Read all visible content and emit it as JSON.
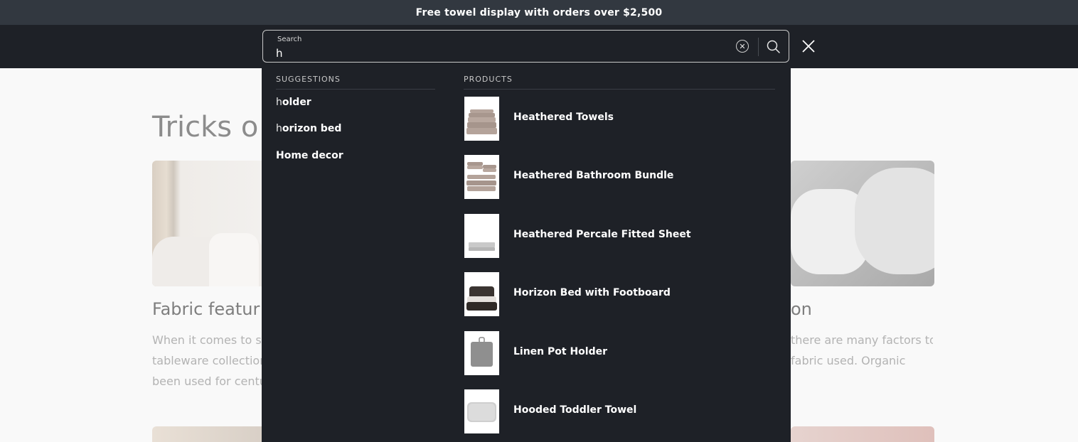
{
  "announcement": "Free towel display with orders over $2,500",
  "page": {
    "title": "Tricks o",
    "cards": [
      {
        "heading": "Fabric featur",
        "text": [
          "When it comes to se",
          "tableware collections",
          "been used for centur"
        ]
      },
      {
        "heading": "on",
        "text": [
          "there are many factors to",
          "fabric used. Organic"
        ]
      }
    ]
  },
  "search": {
    "label": "Search",
    "value": "h",
    "clear_glyph": "✕"
  },
  "dropdown": {
    "suggestions_heading": "SUGGESTIONS",
    "products_heading": "PRODUCTS",
    "suggestions": [
      {
        "typed": "h",
        "rest": "older"
      },
      {
        "typed": "h",
        "rest": "orizon bed"
      },
      {
        "typed": "",
        "rest": "Home decor"
      }
    ],
    "products": [
      {
        "name": "Heathered Towels",
        "icon": "towel-stack-icon"
      },
      {
        "name": "Heathered Bathroom Bundle",
        "icon": "bathroom-bundle-icon"
      },
      {
        "name": "Heathered Percale Fitted Sheet",
        "icon": "fitted-sheet-icon"
      },
      {
        "name": "Horizon Bed with Footboard",
        "icon": "bed-icon"
      },
      {
        "name": "Linen Pot Holder",
        "icon": "pot-holder-icon"
      },
      {
        "name": "Hooded Toddler Towel",
        "icon": "toddler-towel-icon"
      }
    ]
  },
  "colors": {
    "header_bg": "#1e2127",
    "announcement_bg": "#323840",
    "text_light": "#ffffff"
  }
}
